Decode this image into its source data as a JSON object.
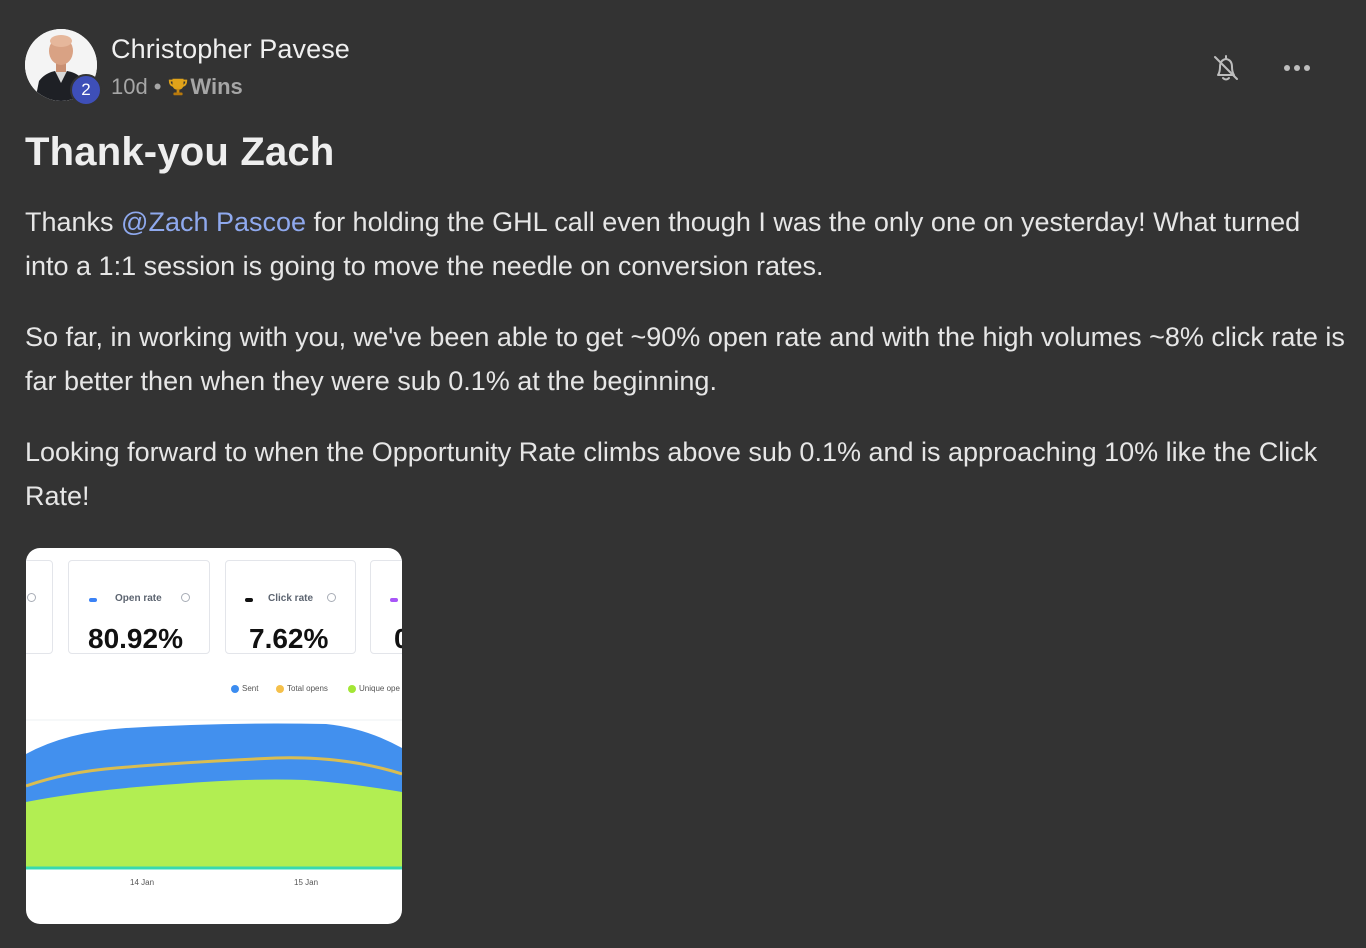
{
  "post": {
    "author": "Christopher Pavese",
    "level": "2",
    "time_ago": "10d",
    "separator": "•",
    "category": "Wins",
    "title": "Thank-you Zach",
    "paragraphs": [
      {
        "before": "Thanks ",
        "mention": "@Zach Pascoe",
        "after": " for holding the GHL call even though I was the only one on yesterday! What turned into a 1:1 session is going to move the needle on conversion rates."
      },
      "So far, in working with you, we've been able to get ~90% open rate and with the high volumes ~8% click rate is far better then when they were sub 0.1% at the beginning.",
      "Looking forward to when the Opportunity Rate climbs above sub 0.1% and is approaching 10% like the Click Rate!"
    ],
    "icons": {
      "notifications": "bell-off-icon",
      "more": "more-horizontal-icon",
      "category": "trophy-icon"
    }
  },
  "attachment": {
    "stats": [
      {
        "label": "Open rate",
        "value": "80.92%",
        "color": "#3b82f6"
      },
      {
        "label": "Click rate",
        "value": "7.62%",
        "color": "#111111"
      },
      {
        "label": "",
        "value": "0",
        "color": "#a855f7"
      }
    ],
    "legend": [
      {
        "label": "Sent",
        "color": "#3b8cf0"
      },
      {
        "label": "Total opens",
        "color": "#f5c04a"
      },
      {
        "label": "Unique ope",
        "color": "#a3e635"
      }
    ],
    "x_labels": [
      "14 Jan",
      "15 Jan"
    ],
    "colors": {
      "sent": "#4290ee",
      "total_opens": "#d9bd52",
      "unique_opens": "#b2ee52",
      "baseline": "#38d9b0"
    }
  }
}
